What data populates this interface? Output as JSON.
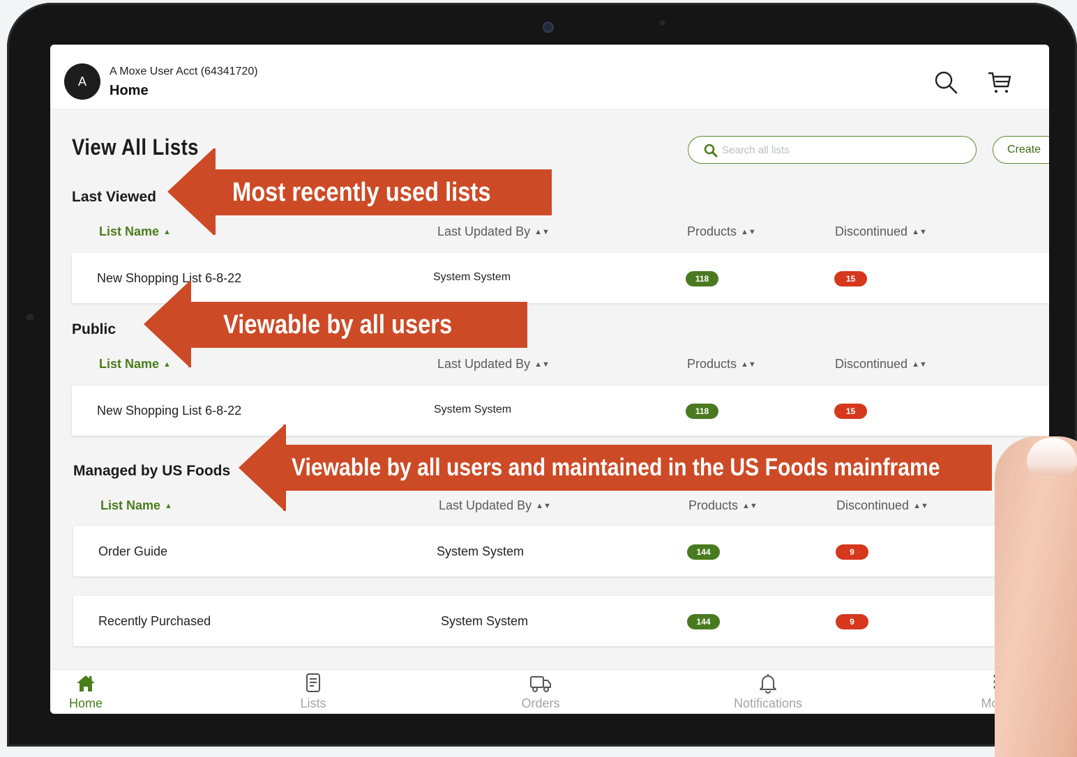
{
  "header": {
    "avatar_letter": "A",
    "account": "A Moxe User Acct (64341720)",
    "page": "Home"
  },
  "main": {
    "title": "View All Lists",
    "search_placeholder": "Search all lists",
    "create_label": "Create"
  },
  "columns": {
    "list_name": "List Name",
    "updated_by": "Last Updated By",
    "products": "Products",
    "discontinued": "Discontinued"
  },
  "sections": [
    {
      "title": "Last Viewed",
      "rows": [
        {
          "name": "New Shopping List 6-8-22",
          "updated_by": "System System",
          "products": "118",
          "discontinued": "15"
        }
      ]
    },
    {
      "title": "Public",
      "rows": [
        {
          "name": "New Shopping List 6-8-22",
          "updated_by": "System System",
          "products": "118",
          "discontinued": "15"
        }
      ]
    },
    {
      "title": "Managed by US Foods",
      "rows": [
        {
          "name": "Order Guide",
          "updated_by": "System System",
          "products": "144",
          "discontinued": "9"
        },
        {
          "name": "Recently Purchased",
          "updated_by": "System System",
          "products": "144",
          "discontinued": "9"
        }
      ]
    }
  ],
  "annotations": {
    "last_viewed": "Most recently used lists",
    "public": "Viewable by all users",
    "managed": "Viewable by all users and maintained  in the US Foods mainframe"
  },
  "nav": {
    "home": "Home",
    "lists": "Lists",
    "orders": "Orders",
    "notifications": "Notifications",
    "more": "More"
  },
  "colors": {
    "accent_green": "#4a7d1c",
    "badge_green": "#4a7a1f",
    "badge_red": "#d5381c",
    "annotation": "#cd4a26"
  }
}
